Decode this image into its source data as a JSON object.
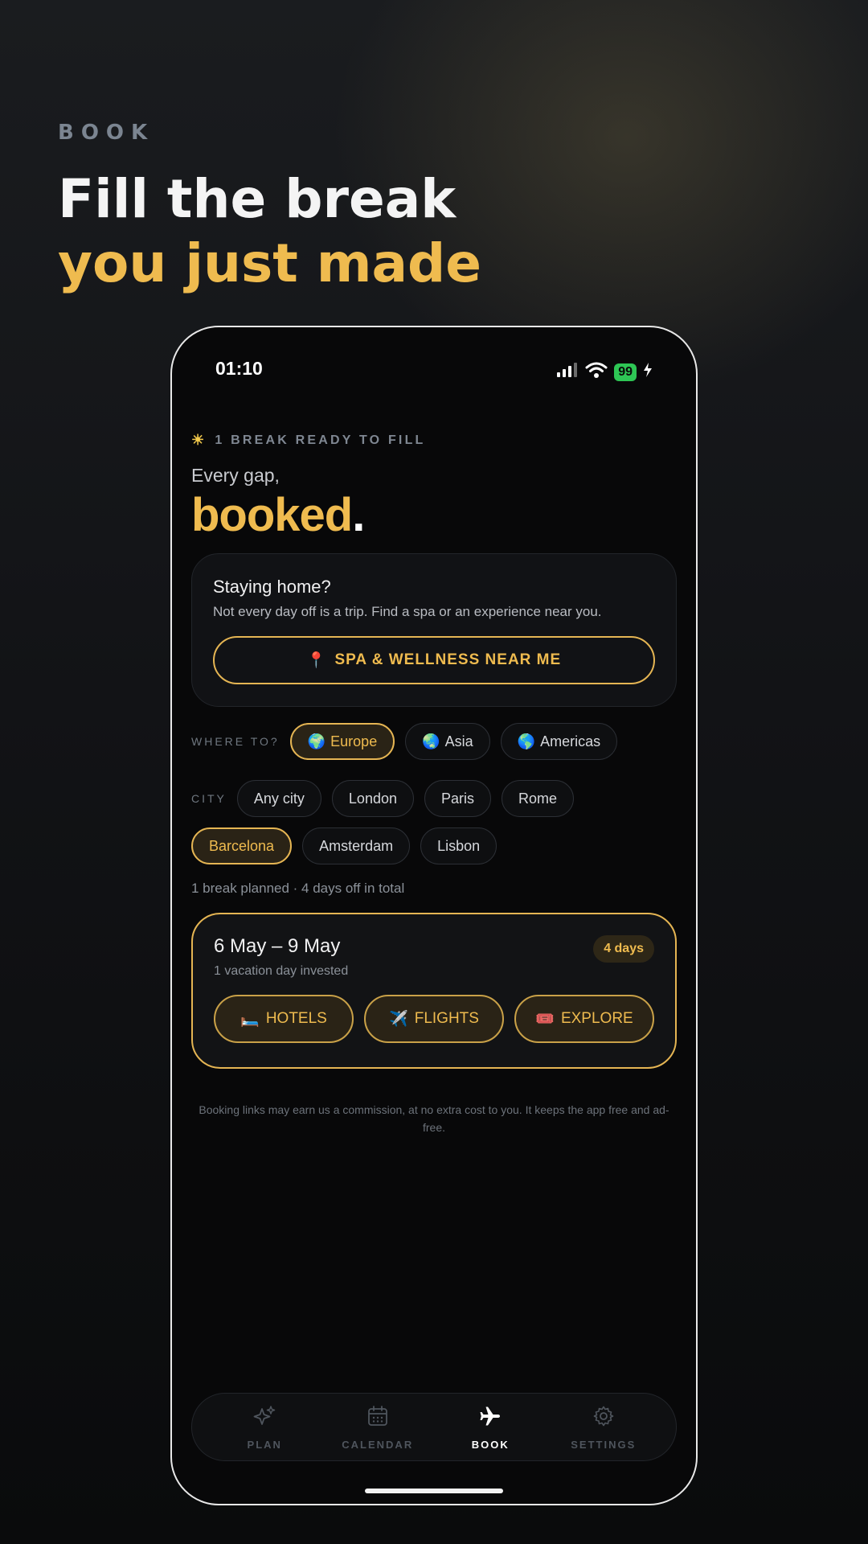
{
  "hero": {
    "eyebrow": "BOOK",
    "headline_line1": "Fill the break",
    "headline_line2": "you just made"
  },
  "status_bar": {
    "time": "01:10",
    "battery": "99"
  },
  "header": {
    "ready_text": "1 BREAK READY TO FILL",
    "kicker": "Every gap,",
    "title": "booked",
    "title_dot": "."
  },
  "home_card": {
    "title": "Staying home?",
    "subtitle": "Not every day off is a trip. Find a spa or an experience near you.",
    "button_icon": "📍",
    "button_label": "SPA & WELLNESS NEAR ME"
  },
  "where_to": {
    "label": "WHERE TO?",
    "options": [
      {
        "icon": "🌍",
        "label": "Europe",
        "selected": true
      },
      {
        "icon": "🌏",
        "label": "Asia",
        "selected": false
      },
      {
        "icon": "🌎",
        "label": "Americas",
        "selected": false
      }
    ]
  },
  "city": {
    "label": "CITY",
    "options": [
      {
        "label": "Any city",
        "selected": false
      },
      {
        "label": "London",
        "selected": false
      },
      {
        "label": "Paris",
        "selected": false
      },
      {
        "label": "Rome",
        "selected": false
      },
      {
        "label": "Barcelona",
        "selected": true
      },
      {
        "label": "Amsterdam",
        "selected": false
      },
      {
        "label": "Lisbon",
        "selected": false
      }
    ]
  },
  "summary": "1 break planned · 4 days off in total",
  "break_card": {
    "dates": "6 May – 9 May",
    "invested": "1 vacation day invested",
    "badge": "4 days",
    "actions": [
      {
        "icon": "🛏️",
        "label": "HOTELS"
      },
      {
        "icon": "✈️",
        "label": "FLIGHTS"
      },
      {
        "icon": "🎟️",
        "label": "EXPLORE"
      }
    ]
  },
  "disclaimer": "Booking links may earn us a commission, at no extra cost to you. It keeps the app free and ad-free.",
  "tabbar": {
    "plan": "PLAN",
    "calendar": "CALENDAR",
    "book": "BOOK",
    "settings": "SETTINGS"
  },
  "colors": {
    "accent": "#efbb4f",
    "background": "#080809",
    "battery": "#2ec655"
  }
}
